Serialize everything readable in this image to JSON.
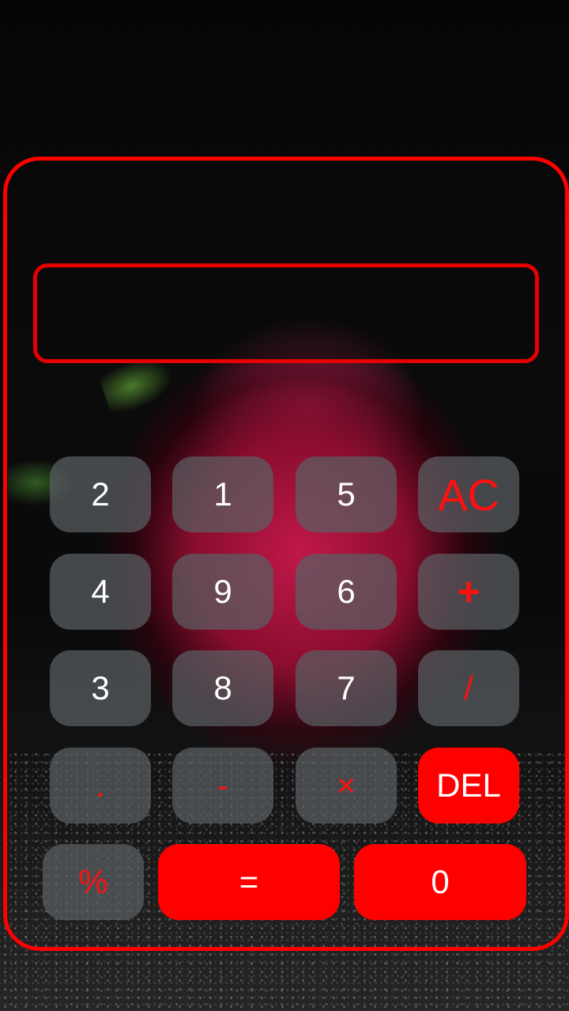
{
  "display": {
    "value": ""
  },
  "colors": {
    "accent": "#ff0000",
    "key_bg": "#5a6064",
    "operator_text": "#ff1010"
  },
  "keypad": {
    "row1": [
      "2",
      "1",
      "5",
      "AC"
    ],
    "row2": [
      "4",
      "9",
      "6",
      "+"
    ],
    "row3": [
      "3",
      "8",
      "7",
      "/"
    ],
    "row4": [
      ".",
      "-",
      "×",
      "DEL"
    ],
    "row5": [
      "%",
      "=",
      "0"
    ]
  }
}
